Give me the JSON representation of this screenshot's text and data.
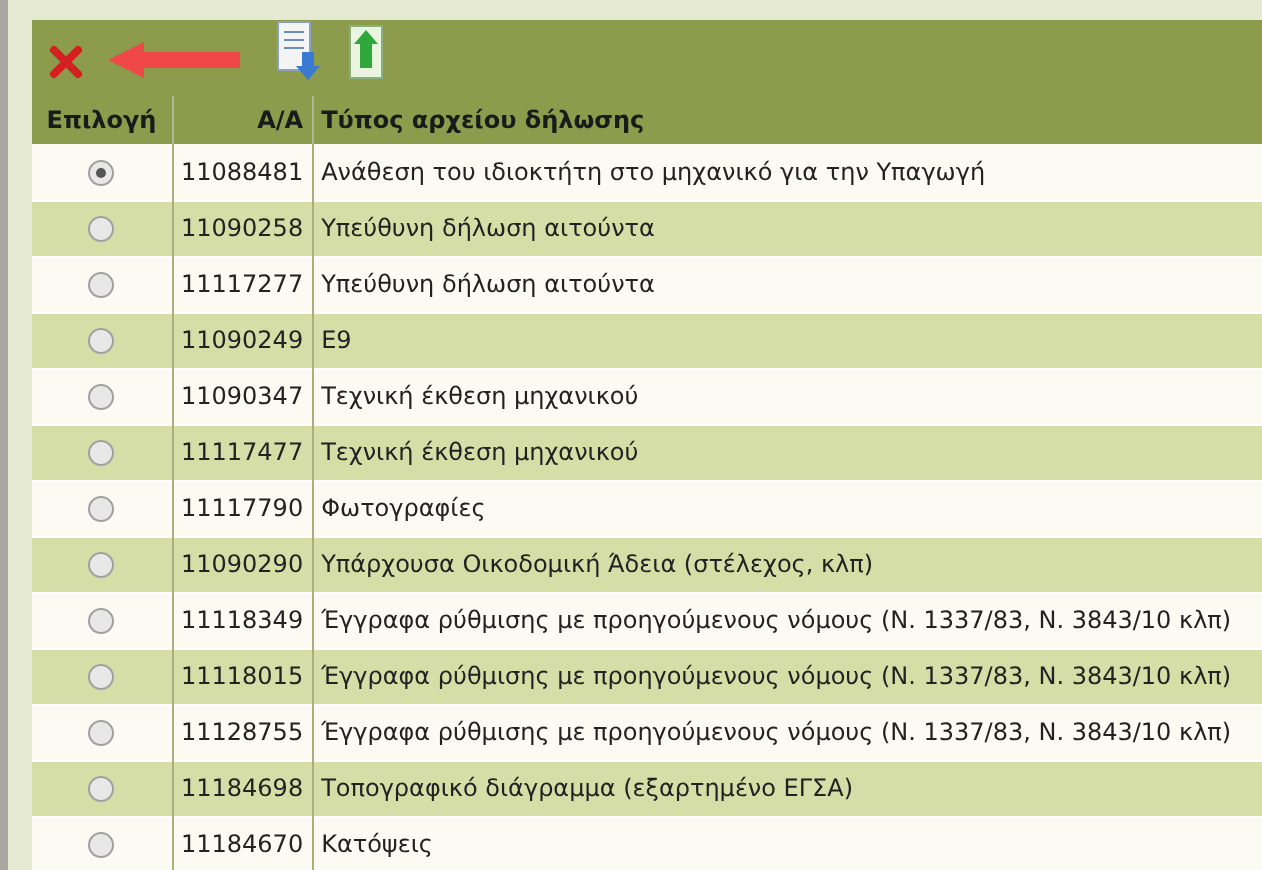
{
  "table": {
    "columns": [
      "Επιλογή",
      "A/A",
      "Τύπος αρχείου δήλωσης"
    ],
    "rows": [
      {
        "selected": true,
        "id": "11088481",
        "type": "Ανάθεση του ιδιοκτήτη στο μηχανικό για την Υπαγωγή"
      },
      {
        "selected": false,
        "id": "11090258",
        "type": "Υπεύθυνη δήλωση αιτούντα"
      },
      {
        "selected": false,
        "id": "11117277",
        "type": "Υπεύθυνη δήλωση αιτούντα"
      },
      {
        "selected": false,
        "id": "11090249",
        "type": "Ε9"
      },
      {
        "selected": false,
        "id": "11090347",
        "type": "Τεχνική έκθεση μηχανικού"
      },
      {
        "selected": false,
        "id": "11117477",
        "type": "Τεχνική έκθεση μηχανικού"
      },
      {
        "selected": false,
        "id": "11117790",
        "type": "Φωτογραφίες"
      },
      {
        "selected": false,
        "id": "11090290",
        "type": "Υπάρχουσα Οικοδομική Άδεια (στέλεχος, κλπ)"
      },
      {
        "selected": false,
        "id": "11118349",
        "type": "Έγγραφα ρύθμισης με προηγούμενους νόμους (Ν. 1337/83, Ν. 3843/10 κλπ)"
      },
      {
        "selected": false,
        "id": "11118015",
        "type": "Έγγραφα ρύθμισης με προηγούμενους νόμους (Ν. 1337/83, Ν. 3843/10 κλπ)"
      },
      {
        "selected": false,
        "id": "11128755",
        "type": "Έγγραφα ρύθμισης με προηγούμενους νόμους (Ν. 1337/83, Ν. 3843/10 κλπ)"
      },
      {
        "selected": false,
        "id": "11184698",
        "type": "Τοπογραφικό διάγραμμα (εξαρτημένο ΕΓΣΑ)"
      },
      {
        "selected": false,
        "id": "11184670",
        "type": "Κατόψεις"
      }
    ]
  }
}
